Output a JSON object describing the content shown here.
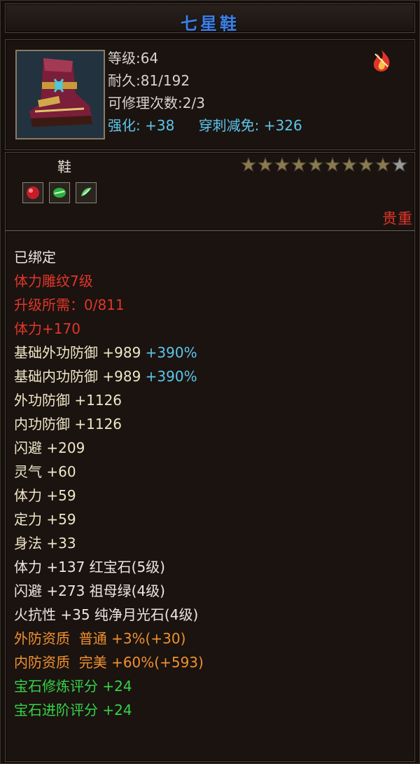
{
  "title": "七星鞋",
  "header": {
    "level_label": "等级:64",
    "durability_label": "耐久:81/192",
    "repair_label": "可修理次数:2/3",
    "enhance_label": "强化:",
    "enhance_value": "+38",
    "pierce_label": "穿刺减免:",
    "pierce_value": "+326",
    "item_icon": "boot-icon",
    "bound_icon": "flame-emblem-icon"
  },
  "middle": {
    "type": "鞋",
    "stars_filled": 9,
    "stars_total": 10,
    "gems": [
      "ruby-gem-icon",
      "emerald-gem-icon",
      "moonstone-gem-icon"
    ],
    "rarity": "贵重"
  },
  "attrs": [
    {
      "parts": [
        {
          "t": "已绑定",
          "c": "white"
        }
      ]
    },
    {
      "parts": [
        {
          "t": "体力雕纹7级",
          "c": "red"
        }
      ]
    },
    {
      "parts": [
        {
          "t": "升级所需：0/811",
          "c": "red"
        }
      ]
    },
    {
      "parts": [
        {
          "t": "体力+170",
          "c": "red"
        }
      ]
    },
    {
      "parts": [
        {
          "t": "基础外功防御 +989 ",
          "c": "cream"
        },
        {
          "t": "+390%",
          "c": "cyan"
        }
      ]
    },
    {
      "parts": [
        {
          "t": "基础内功防御 +989 ",
          "c": "cream"
        },
        {
          "t": "+390%",
          "c": "cyan"
        }
      ]
    },
    {
      "parts": [
        {
          "t": "外功防御 +1126",
          "c": "cream"
        }
      ]
    },
    {
      "parts": [
        {
          "t": "内功防御 +1126",
          "c": "cream"
        }
      ]
    },
    {
      "parts": [
        {
          "t": "闪避 +209",
          "c": "cream"
        }
      ]
    },
    {
      "parts": [
        {
          "t": "灵气 +60",
          "c": "cream"
        }
      ]
    },
    {
      "parts": [
        {
          "t": "体力 +59",
          "c": "cream"
        }
      ]
    },
    {
      "parts": [
        {
          "t": "定力 +59",
          "c": "cream"
        }
      ]
    },
    {
      "parts": [
        {
          "t": "身法 +33",
          "c": "cream"
        }
      ]
    },
    {
      "parts": [
        {
          "t": "体力 +137 红宝石(5级)",
          "c": "white"
        }
      ]
    },
    {
      "parts": [
        {
          "t": "闪避 +273 祖母绿(4级)",
          "c": "white"
        }
      ]
    },
    {
      "parts": [
        {
          "t": "火抗性 +35 纯净月光石(4级)",
          "c": "white"
        }
      ]
    },
    {
      "parts": [
        {
          "t": "外防资质  普通 +3%(+30)",
          "c": "orange"
        }
      ]
    },
    {
      "parts": [
        {
          "t": "内防资质  完美 +60%(+593)",
          "c": "orange"
        }
      ]
    },
    {
      "parts": [
        {
          "t": "宝石修炼评分 +24",
          "c": "green"
        }
      ]
    },
    {
      "parts": [
        {
          "t": "宝石进阶评分 +24",
          "c": "green"
        }
      ]
    }
  ],
  "colors": {
    "title_blue": "#3f7fe0",
    "red": "#e2362a",
    "cream": "#f0e6c6",
    "orange": "#f0912e",
    "green": "#35d446",
    "cyan": "#5ec5ea"
  }
}
